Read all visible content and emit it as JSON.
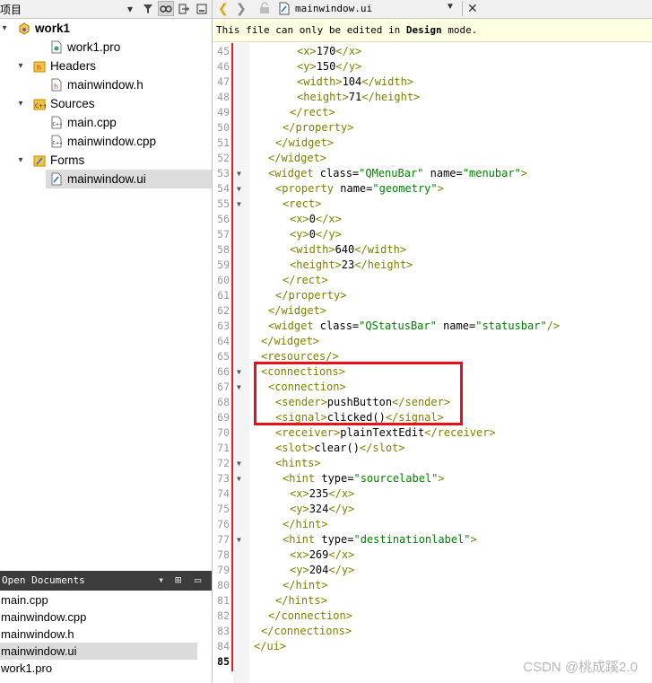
{
  "projects_panel": {
    "title": "项目",
    "tree": [
      {
        "label": "work1",
        "depth": 0,
        "expanded": true,
        "icon": "project-icon",
        "bold": true
      },
      {
        "label": "work1.pro",
        "depth": 2,
        "icon": "pro-file-icon"
      },
      {
        "label": "Headers",
        "depth": 1,
        "expanded": true,
        "icon": "headers-folder-icon"
      },
      {
        "label": "mainwindow.h",
        "depth": 2,
        "icon": "header-file-icon"
      },
      {
        "label": "Sources",
        "depth": 1,
        "expanded": true,
        "icon": "sources-folder-icon"
      },
      {
        "label": "main.cpp",
        "depth": 2,
        "icon": "cpp-file-icon"
      },
      {
        "label": "mainwindow.cpp",
        "depth": 2,
        "icon": "cpp-file-icon"
      },
      {
        "label": "Forms",
        "depth": 1,
        "expanded": true,
        "icon": "forms-folder-icon"
      },
      {
        "label": "mainwindow.ui",
        "depth": 2,
        "icon": "ui-file-icon",
        "selected": true
      }
    ]
  },
  "open_documents": {
    "title": "Open Documents",
    "items": [
      {
        "label": "main.cpp"
      },
      {
        "label": "mainwindow.cpp"
      },
      {
        "label": "mainwindow.h"
      },
      {
        "label": "mainwindow.ui",
        "selected": true
      },
      {
        "label": "work1.pro"
      }
    ]
  },
  "editor": {
    "filename": "mainwindow.ui",
    "notice_prefix": "This file can only be edited in ",
    "notice_bold": "Design",
    "notice_suffix": " mode.",
    "current_line": 85,
    "lines": [
      {
        "n": 45,
        "indent": 6,
        "parts": [
          [
            "tag",
            "<x>"
          ],
          [
            "txt",
            "170"
          ],
          [
            "tag",
            "</x>"
          ]
        ]
      },
      {
        "n": 46,
        "indent": 6,
        "parts": [
          [
            "tag",
            "<y>"
          ],
          [
            "txt",
            "150"
          ],
          [
            "tag",
            "</y>"
          ]
        ]
      },
      {
        "n": 47,
        "indent": 6,
        "parts": [
          [
            "tag",
            "<width>"
          ],
          [
            "txt",
            "104"
          ],
          [
            "tag",
            "</width>"
          ]
        ]
      },
      {
        "n": 48,
        "indent": 6,
        "parts": [
          [
            "tag",
            "<height>"
          ],
          [
            "txt",
            "71"
          ],
          [
            "tag",
            "</height>"
          ]
        ]
      },
      {
        "n": 49,
        "indent": 5,
        "parts": [
          [
            "tag",
            "</rect>"
          ]
        ]
      },
      {
        "n": 50,
        "indent": 4,
        "parts": [
          [
            "tag",
            "</property>"
          ]
        ]
      },
      {
        "n": 51,
        "indent": 3,
        "parts": [
          [
            "tag",
            "</widget>"
          ]
        ]
      },
      {
        "n": 52,
        "indent": 2,
        "parts": [
          [
            "tag",
            "</widget>"
          ]
        ]
      },
      {
        "n": 53,
        "indent": 2,
        "fold": true,
        "parts": [
          [
            "tag",
            "<widget "
          ],
          [
            "attr",
            "class="
          ],
          [
            "val",
            "\"QMenuBar\""
          ],
          [
            "attr",
            " name="
          ],
          [
            "val",
            "\"menubar\""
          ],
          [
            "tag",
            ">"
          ]
        ]
      },
      {
        "n": 54,
        "indent": 3,
        "fold": true,
        "parts": [
          [
            "tag",
            "<property "
          ],
          [
            "attr",
            "name="
          ],
          [
            "val",
            "\"geometry\""
          ],
          [
            "tag",
            ">"
          ]
        ]
      },
      {
        "n": 55,
        "indent": 4,
        "fold": true,
        "parts": [
          [
            "tag",
            "<rect>"
          ]
        ]
      },
      {
        "n": 56,
        "indent": 5,
        "parts": [
          [
            "tag",
            "<x>"
          ],
          [
            "txt",
            "0"
          ],
          [
            "tag",
            "</x>"
          ]
        ]
      },
      {
        "n": 57,
        "indent": 5,
        "parts": [
          [
            "tag",
            "<y>"
          ],
          [
            "txt",
            "0"
          ],
          [
            "tag",
            "</y>"
          ]
        ]
      },
      {
        "n": 58,
        "indent": 5,
        "parts": [
          [
            "tag",
            "<width>"
          ],
          [
            "txt",
            "640"
          ],
          [
            "tag",
            "</width>"
          ]
        ]
      },
      {
        "n": 59,
        "indent": 5,
        "parts": [
          [
            "tag",
            "<height>"
          ],
          [
            "txt",
            "23"
          ],
          [
            "tag",
            "</height>"
          ]
        ]
      },
      {
        "n": 60,
        "indent": 4,
        "parts": [
          [
            "tag",
            "</rect>"
          ]
        ]
      },
      {
        "n": 61,
        "indent": 3,
        "parts": [
          [
            "tag",
            "</property>"
          ]
        ]
      },
      {
        "n": 62,
        "indent": 2,
        "parts": [
          [
            "tag",
            "</widget>"
          ]
        ]
      },
      {
        "n": 63,
        "indent": 2,
        "parts": [
          [
            "tag",
            "<widget "
          ],
          [
            "attr",
            "class="
          ],
          [
            "val",
            "\"QStatusBar\""
          ],
          [
            "attr",
            " name="
          ],
          [
            "val",
            "\"statusbar\""
          ],
          [
            "tag",
            "/>"
          ]
        ]
      },
      {
        "n": 64,
        "indent": 1,
        "parts": [
          [
            "tag",
            "</widget>"
          ]
        ]
      },
      {
        "n": 65,
        "indent": 1,
        "parts": [
          [
            "tag",
            "<resources/>"
          ]
        ]
      },
      {
        "n": 66,
        "indent": 1,
        "fold": true,
        "parts": [
          [
            "tag",
            "<connections>"
          ]
        ]
      },
      {
        "n": 67,
        "indent": 2,
        "fold": true,
        "parts": [
          [
            "tag",
            "<connection>"
          ]
        ]
      },
      {
        "n": 68,
        "indent": 3,
        "parts": [
          [
            "tag",
            "<sender>"
          ],
          [
            "txt",
            "pushButton"
          ],
          [
            "tag",
            "</sender>"
          ]
        ]
      },
      {
        "n": 69,
        "indent": 3,
        "parts": [
          [
            "tag",
            "<signal>"
          ],
          [
            "txt",
            "clicked()"
          ],
          [
            "tag",
            "</signal>"
          ]
        ]
      },
      {
        "n": 70,
        "indent": 3,
        "parts": [
          [
            "tag",
            "<receiver>"
          ],
          [
            "txt",
            "plainTextEdit"
          ],
          [
            "tag",
            "</receiver>"
          ]
        ]
      },
      {
        "n": 71,
        "indent": 3,
        "parts": [
          [
            "tag",
            "<slot>"
          ],
          [
            "txt",
            "clear()"
          ],
          [
            "tag",
            "</slot>"
          ]
        ]
      },
      {
        "n": 72,
        "indent": 3,
        "fold": true,
        "parts": [
          [
            "tag",
            "<hints>"
          ]
        ]
      },
      {
        "n": 73,
        "indent": 4,
        "fold": true,
        "parts": [
          [
            "tag",
            "<hint "
          ],
          [
            "attr",
            "type="
          ],
          [
            "val",
            "\"sourcelabel\""
          ],
          [
            "tag",
            ">"
          ]
        ]
      },
      {
        "n": 74,
        "indent": 5,
        "parts": [
          [
            "tag",
            "<x>"
          ],
          [
            "txt",
            "235"
          ],
          [
            "tag",
            "</x>"
          ]
        ]
      },
      {
        "n": 75,
        "indent": 5,
        "parts": [
          [
            "tag",
            "<y>"
          ],
          [
            "txt",
            "324"
          ],
          [
            "tag",
            "</y>"
          ]
        ]
      },
      {
        "n": 76,
        "indent": 4,
        "parts": [
          [
            "tag",
            "</hint>"
          ]
        ]
      },
      {
        "n": 77,
        "indent": 4,
        "fold": true,
        "parts": [
          [
            "tag",
            "<hint "
          ],
          [
            "attr",
            "type="
          ],
          [
            "val",
            "\"destinationlabel\""
          ],
          [
            "tag",
            ">"
          ]
        ]
      },
      {
        "n": 78,
        "indent": 5,
        "parts": [
          [
            "tag",
            "<x>"
          ],
          [
            "txt",
            "269"
          ],
          [
            "tag",
            "</x>"
          ]
        ]
      },
      {
        "n": 79,
        "indent": 5,
        "parts": [
          [
            "tag",
            "<y>"
          ],
          [
            "txt",
            "204"
          ],
          [
            "tag",
            "</y>"
          ]
        ]
      },
      {
        "n": 80,
        "indent": 4,
        "parts": [
          [
            "tag",
            "</hint>"
          ]
        ]
      },
      {
        "n": 81,
        "indent": 3,
        "parts": [
          [
            "tag",
            "</hints>"
          ]
        ]
      },
      {
        "n": 82,
        "indent": 2,
        "parts": [
          [
            "tag",
            "</connection>"
          ]
        ]
      },
      {
        "n": 83,
        "indent": 1,
        "parts": [
          [
            "tag",
            "</connections>"
          ]
        ]
      },
      {
        "n": 84,
        "indent": 0,
        "parts": [
          [
            "tag",
            "</ui>"
          ]
        ]
      },
      {
        "n": 85,
        "indent": 0,
        "parts": []
      }
    ]
  },
  "colors": {
    "tag": "#808000",
    "value": "#008000",
    "highlight_box": "#e8101a",
    "gutter_bar": "#d22222"
  },
  "watermark": "CSDN @桃成蹊2.0"
}
